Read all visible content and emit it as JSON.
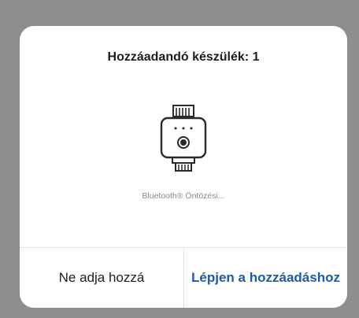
{
  "dialog": {
    "title": "Hozzáadandó készülék: 1",
    "device": {
      "icon": "irrigation-timer-icon",
      "name": "Bluetooth® Öntözési..."
    },
    "buttons": {
      "cancel_label": "Ne adja hozzá",
      "confirm_label": "Lépjen a hozzáadáshoz"
    }
  },
  "colors": {
    "backdrop": "#8e8e8e",
    "dialog_bg": "#ffffff",
    "confirm_text": "#1f5aa8",
    "secondary_text": "#8a8a8a"
  }
}
